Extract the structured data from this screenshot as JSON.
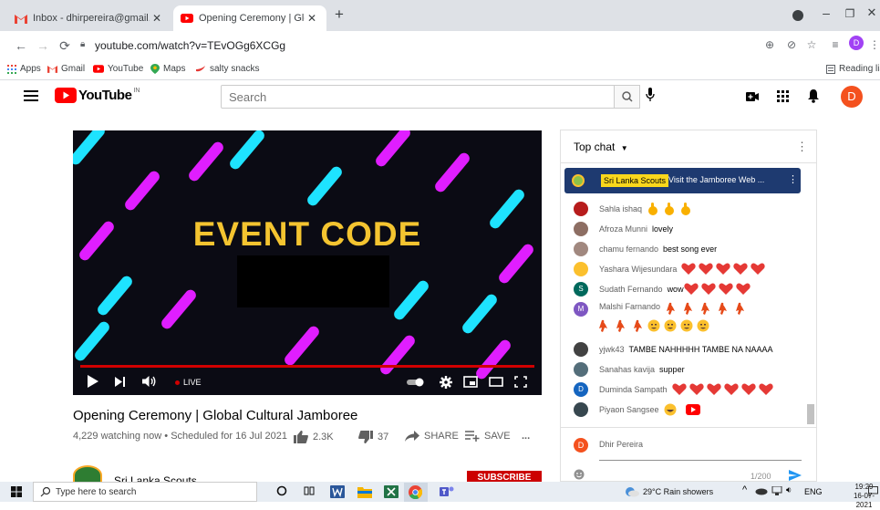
{
  "browser": {
    "tabs": [
      {
        "title": "Inbox - dhirpereira@gmail.com -",
        "active": false
      },
      {
        "title": "Opening Ceremony | Global Cultu",
        "active": true
      }
    ],
    "url": "youtube.com/watch?v=TEvOGg6XCGg",
    "profile_initial": "D",
    "bookmarks": [
      "Apps",
      "Gmail",
      "YouTube",
      "Maps",
      "salty snacks"
    ],
    "reading_list": "Reading lis"
  },
  "youtube": {
    "logo_text": "YouTube",
    "logo_region": "IN",
    "search_placeholder": "Search",
    "avatar_initial": "D"
  },
  "video": {
    "overlay_title": "EVENT CODE",
    "live_label": "LIVE",
    "title": "Opening Ceremony | Global Cultural Jamboree",
    "meta": "4,229 watching now • Scheduled for 16 Jul 2021",
    "likes": "2.3K",
    "dislikes": "37",
    "share_label": "SHARE",
    "save_label": "SAVE",
    "more_label": "...",
    "channel_name": "Sri Lanka Scouts",
    "subscribe_label": "SUBSCRIBE"
  },
  "chat": {
    "header": "Top chat",
    "pinned": {
      "badge": "Sri Lanka Scouts",
      "message": "Visit the Jamboree Web ..."
    },
    "messages": [
      {
        "author": "Sahla ishaq",
        "text": "",
        "avatar_color": "#b71c1c",
        "emoji": "ok x3"
      },
      {
        "author": "Afroza Munni",
        "text": "lovely",
        "avatar_color": "#8d6e63",
        "emoji": ""
      },
      {
        "author": "chamu fernando",
        "text": "best song ever",
        "avatar_color": "#a1887f",
        "emoji": ""
      },
      {
        "author": "Yashara Wijesundara",
        "text": "",
        "avatar_color": "#fbc02d",
        "emoji": "heart x5"
      },
      {
        "author": "Sudath Fernando",
        "text": "wow",
        "avatar_color": "#00695c",
        "avatar_initial": "S",
        "emoji": "heart x4"
      },
      {
        "author": "Malshi Farnando",
        "text": "",
        "avatar_color": "#7e57c2",
        "avatar_initial": "M",
        "emoji": "dancer x5, dancer x3 smile x4"
      },
      {
        "author": "yjwk43",
        "text": "TAMBE NAHHHHH TAMBE NA NAAAA",
        "avatar_color": "#424242",
        "emoji": ""
      },
      {
        "author": "Sanahas kavija",
        "text": "supper",
        "avatar_color": "#546e7a",
        "emoji": ""
      },
      {
        "author": "Duminda Sampath",
        "text": "",
        "avatar_color": "#1565c0",
        "avatar_initial": "D",
        "emoji": "heart x6"
      },
      {
        "author": "Piyaon Sangsee",
        "text": "",
        "avatar_color": "#37474f",
        "emoji": "laugh youtube"
      }
    ],
    "me_name": "Dhir Pereira",
    "me_initial": "D",
    "counter": "1/200"
  },
  "taskbar": {
    "search_placeholder": "Type here to search",
    "weather": "29°C  Rain showers",
    "language": "ENG",
    "time": "19:29",
    "date": "16-07-2021"
  },
  "colors": {
    "youtube_red": "#ff0000",
    "event_title": "#f4c430",
    "pinned_bg": "#1e3a70",
    "subscribe": "#cc0000"
  }
}
